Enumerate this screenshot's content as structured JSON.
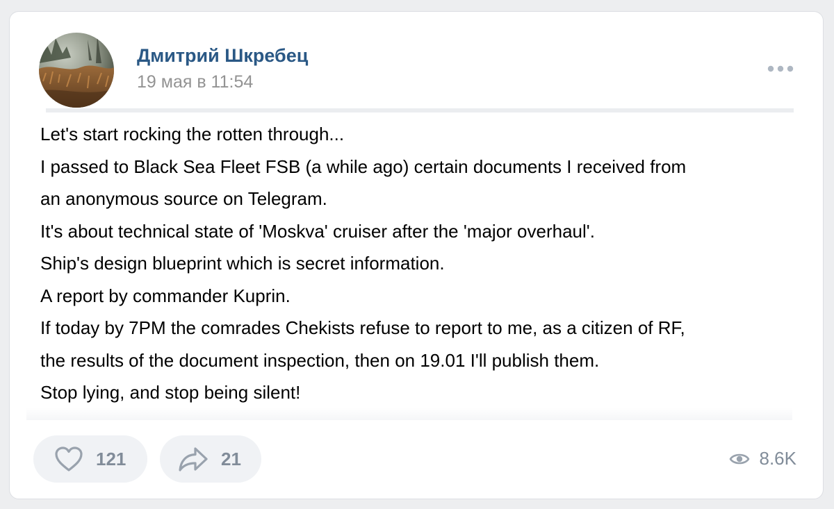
{
  "post": {
    "author": "Дмитрий Шкребец",
    "date": "19 мая в 11:54",
    "lines": [
      "Let's start rocking the rotten through...",
      "I passed to Black Sea Fleet FSB (a while ago) certain documents I received from",
      "an anonymous source on Telegram.",
      "It's about technical state of 'Moskva' cruiser after the 'major overhaul'.",
      "Ship's design blueprint which is secret information.",
      "A report by commander Kuprin.",
      "If today by 7PM the comrades Chekists refuse to report to me, as a citizen of RF,",
      "the results of the document inspection, then on 19.01 I'll publish them.",
      "Stop lying, and stop being silent!"
    ]
  },
  "actions": {
    "like_count": "121",
    "share_count": "21",
    "views_count": "8.6K"
  },
  "icons": {
    "more": "more-dots-icon",
    "like": "heart-icon",
    "share": "share-arrow-icon",
    "views": "eye-icon"
  },
  "colors": {
    "author_link": "#2a5885",
    "muted": "#939393",
    "action_text": "#818c99",
    "button_bg": "#f0f2f5"
  }
}
